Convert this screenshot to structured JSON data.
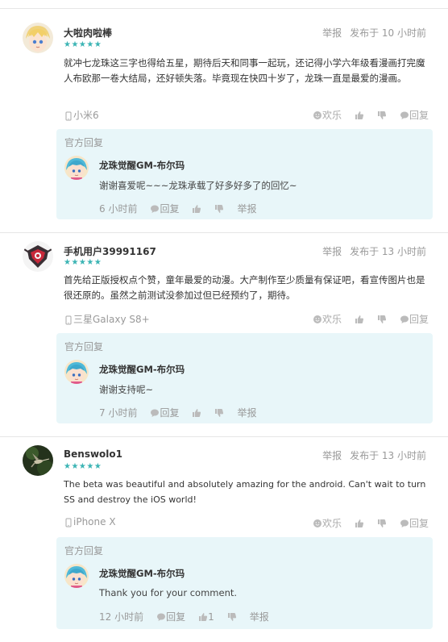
{
  "reviews": [
    {
      "username": "大啦肉啦棒",
      "stars": "★★★★★",
      "report": "举报",
      "posted": "发布于 10 小时前",
      "text": "就冲七龙珠这三字也得给五星，期待后天和同事一起玩，还记得小学六年级看漫画打完魔人布欧那一卷大结局，还好顿失落。毕竟现在快四十岁了，龙珠一直是最爱的漫画。",
      "device": "小米6",
      "funny": "欢乐",
      "reply_action": "回复",
      "official": {
        "label": "官方回复",
        "name": "龙珠觉醒GM-布尔玛",
        "text": "谢谢喜爱呢~~~龙珠承载了好多好多了的回忆~",
        "time": "6 小时前",
        "reply": "回复",
        "like_count": "",
        "report": "举报"
      }
    },
    {
      "username": "手机用户39991167",
      "stars": "★★★★★",
      "report": "举报",
      "posted": "发布于 13 小时前",
      "text": "首先给正版授权点个赞，童年最爱的动漫。大产制作至少质量有保证吧，看宣传图片也是很还原的。虽然之前测试没参加过但已经预约了，期待。",
      "device": "三星Galaxy S8+",
      "funny": "欢乐",
      "reply_action": "回复",
      "official": {
        "label": "官方回复",
        "name": "龙珠觉醒GM-布尔玛",
        "text": "谢谢支持呢~",
        "time": "7 小时前",
        "reply": "回复",
        "like_count": "",
        "report": "举报"
      }
    },
    {
      "username": "Benswolo1",
      "stars": "★★★★★",
      "report": "举报",
      "posted": "发布于 13 小时前",
      "text": "The beta was beautiful and absolutely amazing for the android. Can't wait to turn SS and destroy the iOS world!",
      "device": "iPhone X",
      "funny": "欢乐",
      "reply_action": "回复",
      "official": {
        "label": "官方回复",
        "name": "龙珠觉醒GM-布尔玛",
        "text": "Thank you for your comment.",
        "time": "12 小时前",
        "reply": "回复",
        "like_count": "1",
        "report": "举报"
      }
    }
  ],
  "colors": {
    "star": "#3bb4b4",
    "reply_bg": "#e8f6f9",
    "muted": "#999999",
    "divider": "#e6e6e6"
  },
  "icons": [
    "phone-icon",
    "smile-icon",
    "thumb-up-icon",
    "thumb-down-icon",
    "comment-icon"
  ]
}
